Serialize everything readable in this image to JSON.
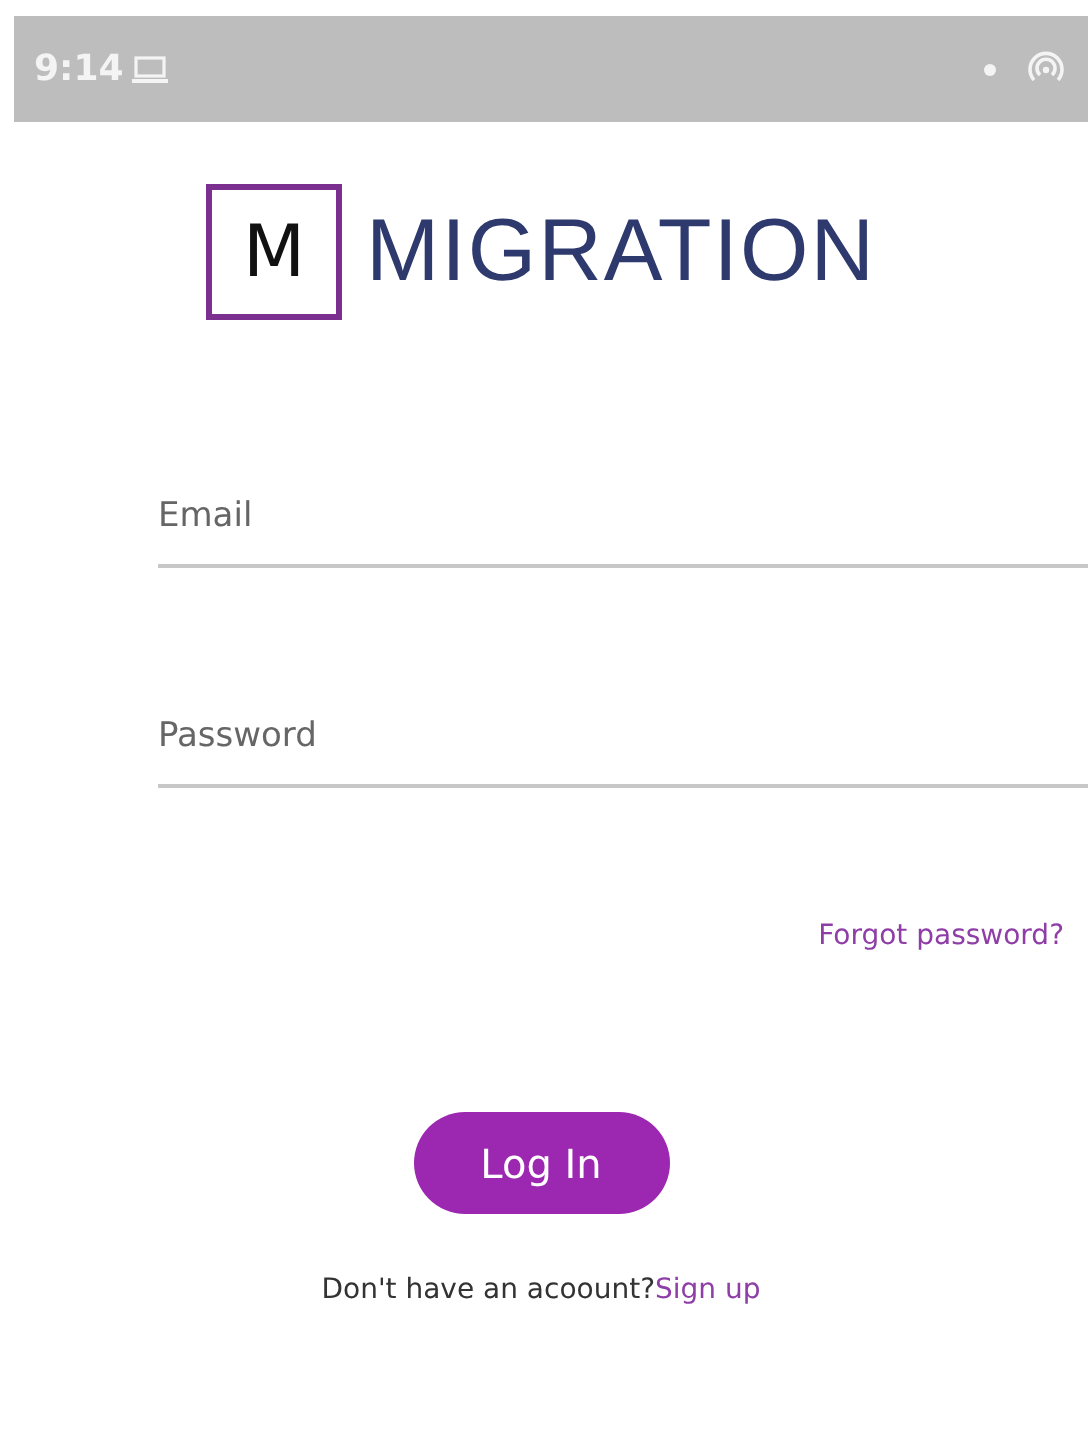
{
  "status_bar": {
    "time": "9:14"
  },
  "logo": {
    "letter": "M",
    "name": "MIGRATION"
  },
  "fields": [
    {
      "placeholder": "Email"
    },
    {
      "placeholder": "Password"
    }
  ],
  "forgot_link": "Forgot password?",
  "login_button": "Log In",
  "signup": {
    "prompt": "Don't have an acoount?",
    "link": "Sign up"
  }
}
